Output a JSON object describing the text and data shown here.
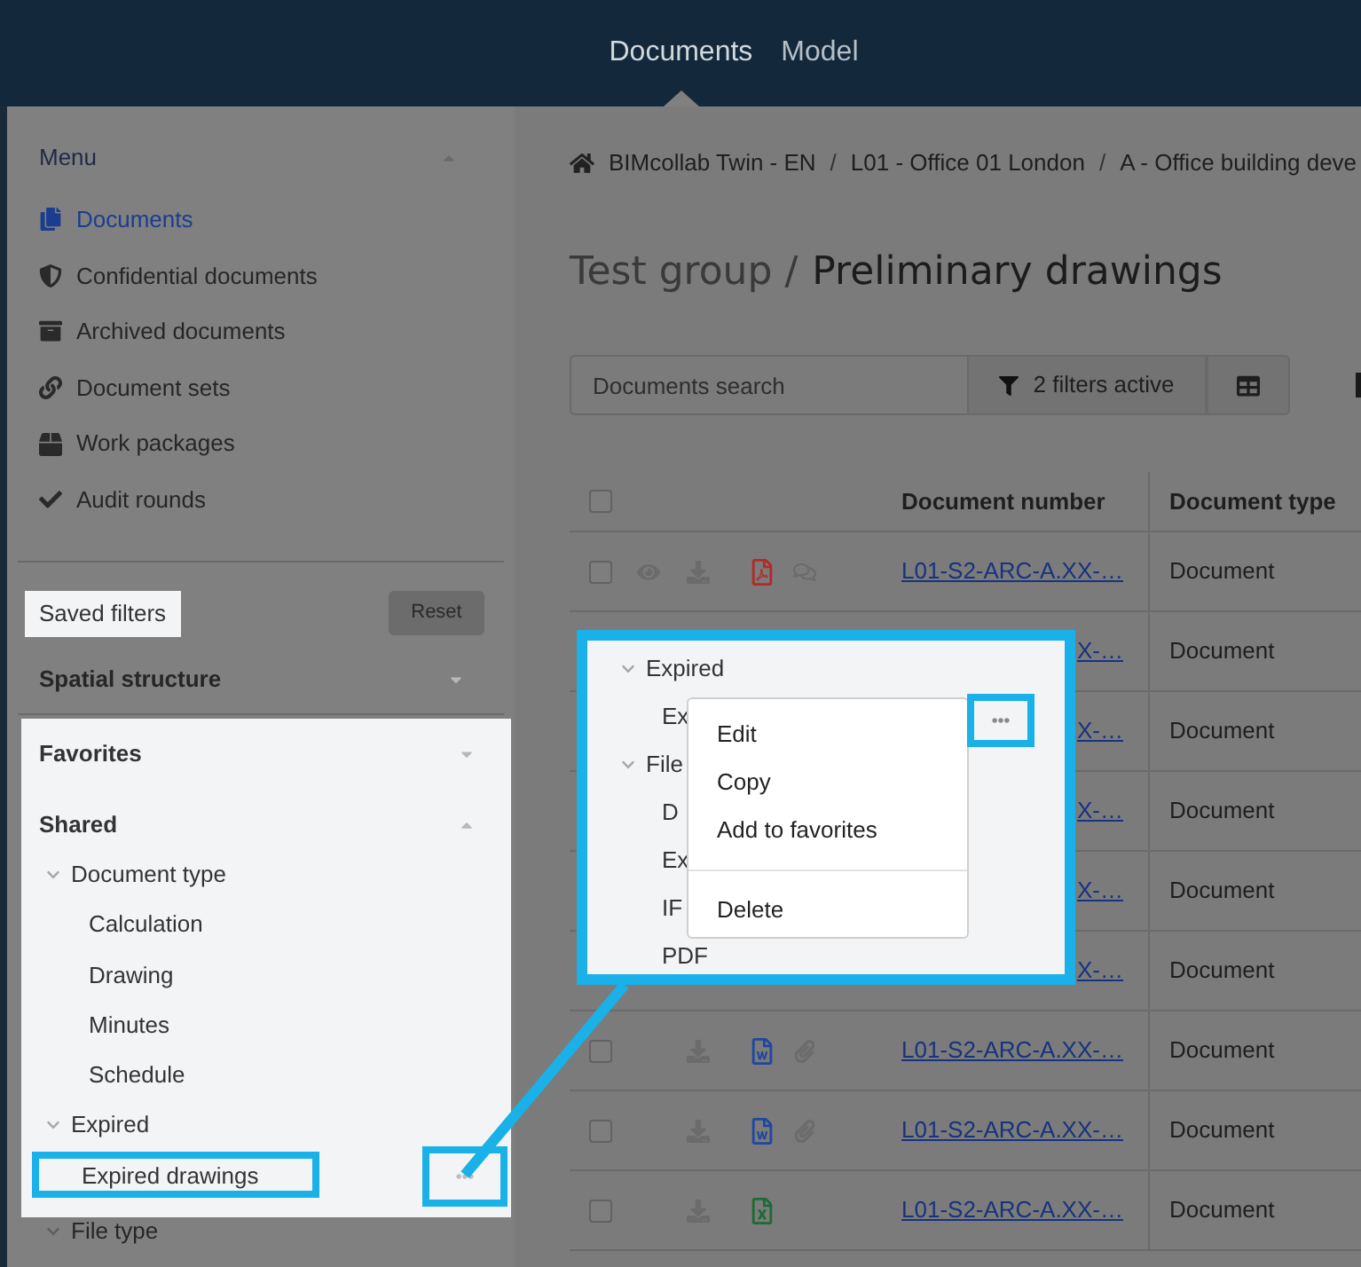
{
  "top_nav": {
    "tabs": [
      {
        "label": "Documents",
        "selected": true
      },
      {
        "label": "Model",
        "selected": false
      }
    ]
  },
  "sidebar": {
    "menu": {
      "title": "Menu",
      "expanded": true,
      "items": [
        {
          "label": "Documents",
          "selected": true
        },
        {
          "label": "Confidential documents",
          "selected": false
        },
        {
          "label": "Archived documents",
          "selected": false
        },
        {
          "label": "Document sets",
          "selected": false
        },
        {
          "label": "Work packages",
          "selected": false
        },
        {
          "label": "Audit rounds",
          "selected": false
        }
      ]
    },
    "saved_filters": {
      "title": "Saved filters",
      "highlighted": true,
      "reset": "Reset"
    },
    "spatial_structure": {
      "title": "Spatial structure",
      "expanded": false
    },
    "panel": {
      "highlighted": true,
      "favorites": {
        "title": "Favorites",
        "expanded": false
      },
      "shared": {
        "title": "Shared",
        "expanded": true
      },
      "tree": [
        {
          "label": "Document type",
          "expanded": true,
          "children": [
            {
              "label": "Calculation",
              "outlined": false
            },
            {
              "label": "Drawing",
              "outlined": false
            },
            {
              "label": "Minutes",
              "outlined": false
            },
            {
              "label": "Schedule",
              "outlined": false
            }
          ]
        },
        {
          "label": "Expired",
          "expanded": true,
          "children": [
            {
              "label": "Expired drawings",
              "outlined": true
            }
          ]
        }
      ]
    },
    "below_panel": [
      {
        "label": "File type",
        "expanded": true
      }
    ]
  },
  "main": {
    "breadcrumb": [
      {
        "kind": "link",
        "text": "BIMcollab Twin - EN"
      },
      {
        "kind": "separator",
        "text": "/"
      },
      {
        "kind": "link",
        "text": "L01 - Office 01 London"
      },
      {
        "kind": "separator",
        "text": "/"
      },
      {
        "kind": "link",
        "text": "A - Office building deve"
      }
    ],
    "title": {
      "group": "Test group /",
      "name": "Preliminary drawings"
    },
    "search": {
      "placeholder": "Documents search"
    },
    "filter_button": "2 filters active",
    "table": {
      "select_all": {
        "checked": false
      },
      "columns": [
        "Document number",
        "Document type"
      ],
      "rows": [
        {
          "kind": "pdf",
          "checked": false,
          "document_number": "L01-S2-ARC-A.XX-…",
          "document_type": "Document"
        },
        {
          "kind": "covered",
          "document_number": "X-…",
          "document_type": "Document"
        },
        {
          "kind": "covered",
          "document_number": "X-…",
          "document_type": "Document"
        },
        {
          "kind": "covered",
          "document_number": "X-…",
          "document_type": "Document"
        },
        {
          "kind": "covered",
          "document_number": "X-…",
          "document_type": "Document"
        },
        {
          "kind": "covered",
          "document_number": "X-…",
          "document_type": "Document"
        },
        {
          "kind": "word",
          "checked": false,
          "document_number": "L01-S2-ARC-A.XX-…",
          "document_type": "Document"
        },
        {
          "kind": "word",
          "checked": false,
          "document_number": "L01-S2-ARC-A.XX-…",
          "document_type": "Document"
        },
        {
          "kind": "excel",
          "checked": false,
          "document_number": "L01-S2-ARC-A.XX-…",
          "document_type": "Document"
        }
      ]
    }
  },
  "callout": {
    "tree": [
      {
        "label": "Expired",
        "expanded": true,
        "children": [
          {
            "label": "Ex"
          }
        ]
      },
      {
        "label": "File",
        "expanded": true,
        "children": [
          {
            "label": "D"
          },
          {
            "label": "Ex"
          },
          {
            "label": "IF"
          },
          {
            "label": "PDF"
          }
        ]
      }
    ],
    "menu": [
      {
        "label": "Edit",
        "divider_before": false
      },
      {
        "label": "Copy",
        "divider_before": false
      },
      {
        "label": "Add to favorites",
        "divider_before": false
      },
      {
        "label": "Delete",
        "divider_before": true
      }
    ]
  }
}
